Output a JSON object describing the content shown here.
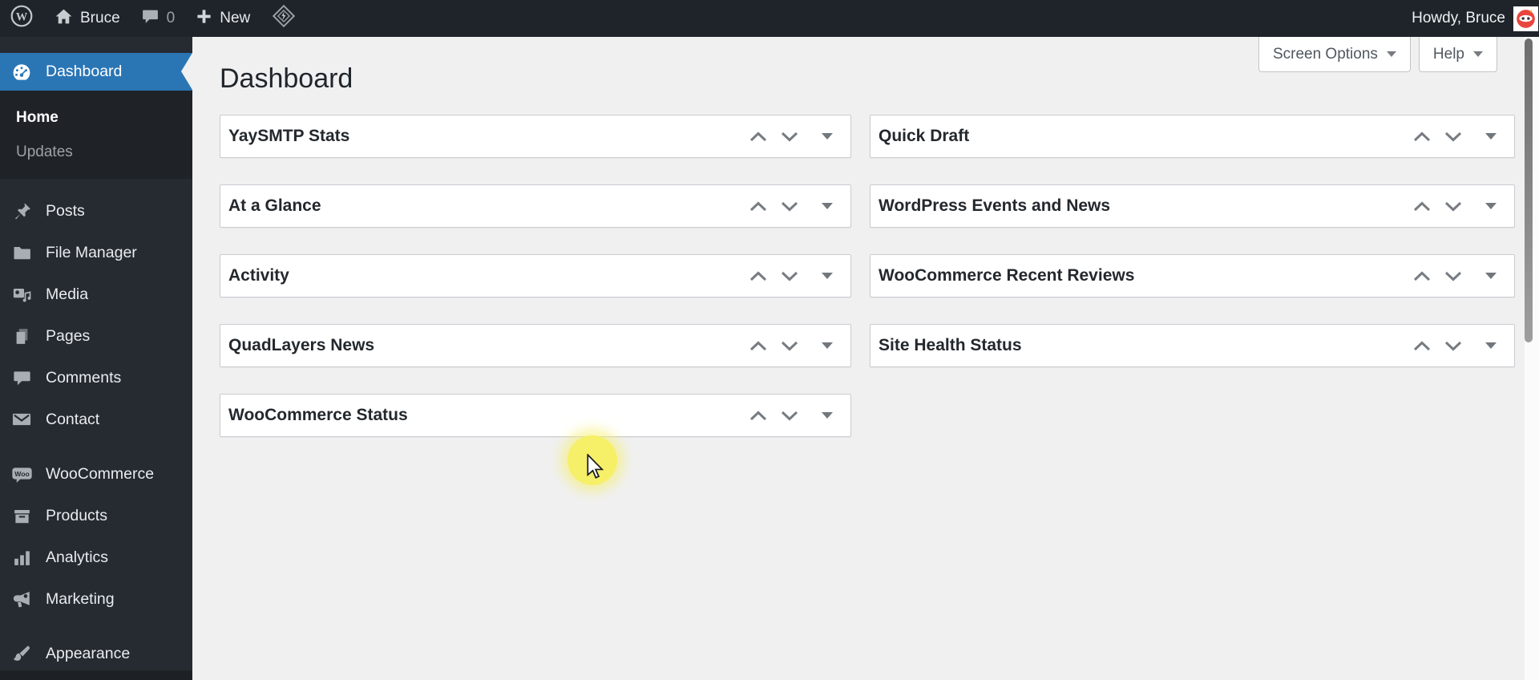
{
  "admin_bar": {
    "wp_logo_letter": "W",
    "site_name": "Bruce",
    "comments_count": "0",
    "new_label": "New",
    "howdy_text": "Howdy, Bruce"
  },
  "page_header": {
    "title": "Dashboard",
    "screen_options_label": "Screen Options",
    "help_label": "Help"
  },
  "sidebar": {
    "woo_badge": "Woo",
    "items": [
      {
        "label": "Dashboard",
        "icon": "dashboard-gauge-icon",
        "active": true
      },
      {
        "label": "Posts",
        "icon": "pin-icon"
      },
      {
        "label": "File Manager",
        "icon": "folder-icon"
      },
      {
        "label": "Media",
        "icon": "camera-note-icon"
      },
      {
        "label": "Pages",
        "icon": "pages-icon"
      },
      {
        "label": "Comments",
        "icon": "comment-bubble-icon"
      },
      {
        "label": "Contact",
        "icon": "envelope-icon"
      },
      {
        "label": "WooCommerce",
        "icon": "woocommerce-badge-icon"
      },
      {
        "label": "Products",
        "icon": "box-icon"
      },
      {
        "label": "Analytics",
        "icon": "bar-chart-icon"
      },
      {
        "label": "Marketing",
        "icon": "megaphone-icon"
      },
      {
        "label": "Appearance",
        "icon": "paintbrush-icon"
      }
    ],
    "submenu": [
      {
        "label": "Home",
        "current": true
      },
      {
        "label": "Updates",
        "current": false
      }
    ]
  },
  "widgets": {
    "left": [
      {
        "title": "YaySMTP Stats"
      },
      {
        "title": "At a Glance"
      },
      {
        "title": "Activity"
      },
      {
        "title": "QuadLayers News"
      },
      {
        "title": "WooCommerce Status"
      }
    ],
    "right": [
      {
        "title": "Quick Draft"
      },
      {
        "title": "WordPress Events and News"
      },
      {
        "title": "WooCommerce Recent Reviews"
      },
      {
        "title": "Site Health Status"
      }
    ]
  },
  "colors": {
    "admin_bar_bg": "#1e242a",
    "sidebar_bg": "#262b31",
    "submenu_bg": "#1f2328",
    "active_blue": "#2a76b5",
    "content_bg": "#f0f0f1",
    "widget_border": "#c9ccd0",
    "highlight_yellow": "#f6ef68"
  }
}
